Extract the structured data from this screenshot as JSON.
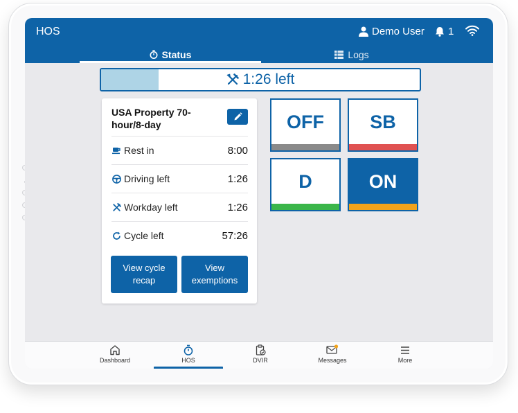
{
  "header": {
    "app_title": "HOS",
    "user_name": "Demo User",
    "notification_count": "1"
  },
  "tabs": [
    {
      "label": "Status",
      "active": true
    },
    {
      "label": "Logs",
      "active": false
    }
  ],
  "progress": {
    "text": "1:26 left",
    "fill_fraction": 0.18
  },
  "ruleset_card": {
    "title": "USA Property 70-hour/8-day",
    "rows": [
      {
        "label": "Rest in",
        "value": "8:00",
        "icon": "coffee-icon"
      },
      {
        "label": "Driving left",
        "value": "1:26",
        "icon": "steering-wheel-icon"
      },
      {
        "label": "Workday left",
        "value": "1:26",
        "icon": "tools-icon"
      },
      {
        "label": "Cycle left",
        "value": "57:26",
        "icon": "cycle-icon"
      }
    ],
    "buttons": {
      "view_cycle_recap": "View cycle recap",
      "view_exemptions": "View exemptions"
    }
  },
  "duty_status": [
    {
      "label": "OFF",
      "color": "#8a8a8a",
      "active": false
    },
    {
      "label": "SB",
      "color": "#e05252",
      "active": false
    },
    {
      "label": "D",
      "color": "#3bb64a",
      "active": false
    },
    {
      "label": "ON",
      "color": "#f2a31b",
      "active": true
    }
  ],
  "bottom_nav": [
    {
      "label": "Dashboard",
      "icon": "home-icon",
      "active": false
    },
    {
      "label": "HOS",
      "icon": "stopwatch-icon",
      "active": true
    },
    {
      "label": "DVIR",
      "icon": "clipboard-check-icon",
      "active": false
    },
    {
      "label": "Messages",
      "icon": "mail-icon",
      "active": false
    },
    {
      "label": "More",
      "icon": "hamburger-icon",
      "active": false
    }
  ],
  "colors": {
    "primary": "#0e63a7",
    "progress_fill": "#aed4e6",
    "message_badge": "#f2a31b"
  }
}
